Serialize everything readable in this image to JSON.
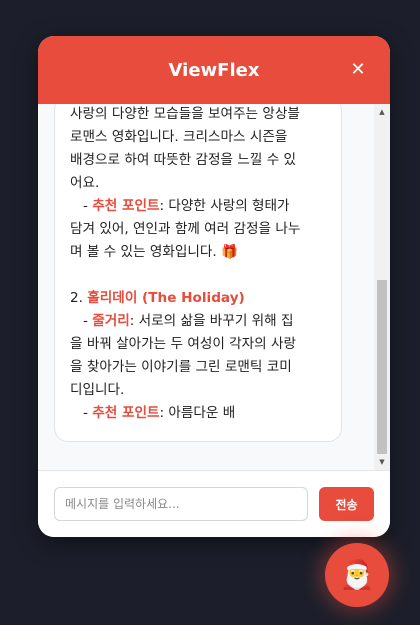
{
  "header": {
    "title": "ViewFlex",
    "close_symbol": "✕"
  },
  "message": {
    "l1": "사랑의 다양한 모습들을 보여주는 앙상블",
    "l2": "로맨스 영화입니다. 크리스마스 시즌을",
    "l3": "배경으로 하여 따뜻한 감정을 느낄 수 있",
    "l4": "어요.",
    "rec1_prefix": "   - ",
    "rec_label": "추천 포인트",
    "rec1_text": ": 다양한 사랑의 형태가\n담겨 있어, 연인과 함께 여러 감정을 나누\n며 볼 수 있는 영화입니다. ",
    "gift_emoji": "🎁",
    "item2_num": "2. ",
    "item2_title": "홀리데이 (The Holiday)",
    "plot_prefix": "   - ",
    "plot_label": "줄거리",
    "plot_text": ": 서로의 삶을 바꾸기 위해 집\n을 바꿔 살아가는 두 여성이 각자의 사랑\n을 찾아가는 이야기를 그린 로맨틱 코미\n디입니다.",
    "rec2_prefix": "   - ",
    "rec2_text": ": 아름다운 배"
  },
  "input": {
    "placeholder": "메시지를 입력하세요...",
    "value": ""
  },
  "send_button": {
    "label": "전송"
  },
  "fab": {
    "emoji": "🎅"
  },
  "colors": {
    "accent": "#e74c3c",
    "background": "#1c1f2b"
  }
}
